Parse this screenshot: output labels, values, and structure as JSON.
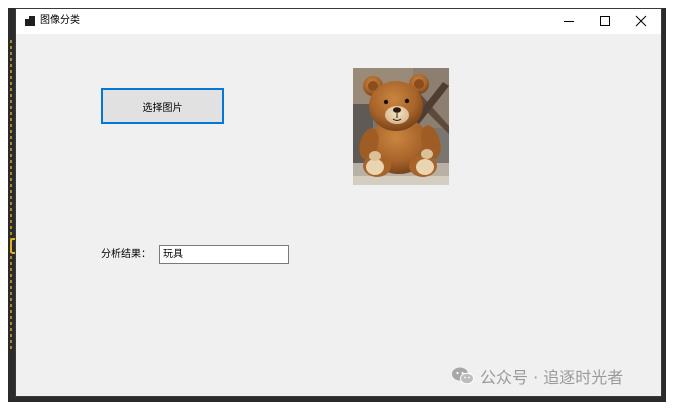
{
  "window": {
    "title": "图像分类",
    "controls": {
      "minimize_icon": "minimize-icon",
      "maximize_icon": "maximize-icon",
      "close_icon": "close-icon"
    }
  },
  "form": {
    "choose_button_label": "选择图片",
    "picture_subject": "teddy bear",
    "result_label": "分析结果：",
    "result_value": "玩具"
  },
  "watermark": {
    "text": "公众号 · 追逐时光者",
    "icon": "wechat-icon"
  },
  "colors": {
    "form_background": "#f0f0f0",
    "button_border_focus": "#0078d7",
    "button_background": "#e1e1e1"
  }
}
